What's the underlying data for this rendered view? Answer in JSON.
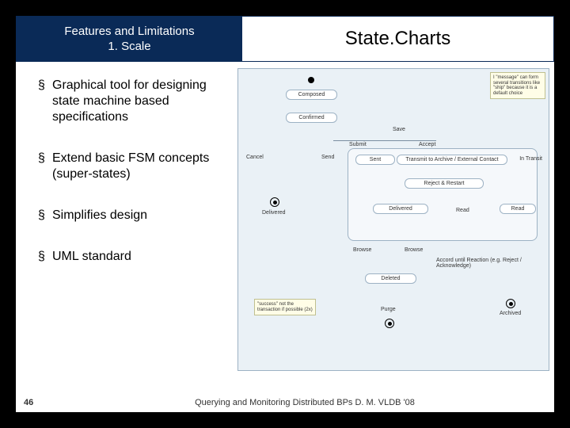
{
  "header": {
    "left_line1": "Features and Limitations",
    "left_line2": "1. Scale",
    "title": "State.Charts"
  },
  "bullets": {
    "b1": "Graphical tool for designing state machine based specifications",
    "b2": "Extend basic FSM concepts (super-states)",
    "b3": "Simplifies design",
    "b4": "UML standard"
  },
  "diagram": {
    "note_top": "I \"message\" can form several transitions like \"ship\" because it is a default choice",
    "note_bottom": "\"success\" not the transaction if possible (2x)",
    "s_composed": "Composed",
    "s_confirmed": "Confirmed",
    "l_save": "Save",
    "l_submit": "Submit",
    "l_cancel": "Cancel",
    "l_send": "Send",
    "l_accept": "Accept",
    "s_sent": "Sent",
    "s_transmit": "Transmit to Archive / External Contact",
    "l_intransit": "In Transit",
    "s_reject_restart": "Reject & Restart",
    "s_delivered": "Delivered",
    "l_read": "Read",
    "s_read": "Read",
    "l_delivered_end": "Delivered",
    "l_browse_l": "Browse",
    "l_browse_r": "Browse",
    "l_accord": "Accord until Reaction (e.g. Reject / Acknowledge)",
    "s_deleted": "Deleted",
    "l_purge": "Purge",
    "l_archived": "Archived"
  },
  "footer": {
    "page": "46",
    "text": "Querying and Monitoring Distributed BPs D. M. VLDB '08"
  }
}
